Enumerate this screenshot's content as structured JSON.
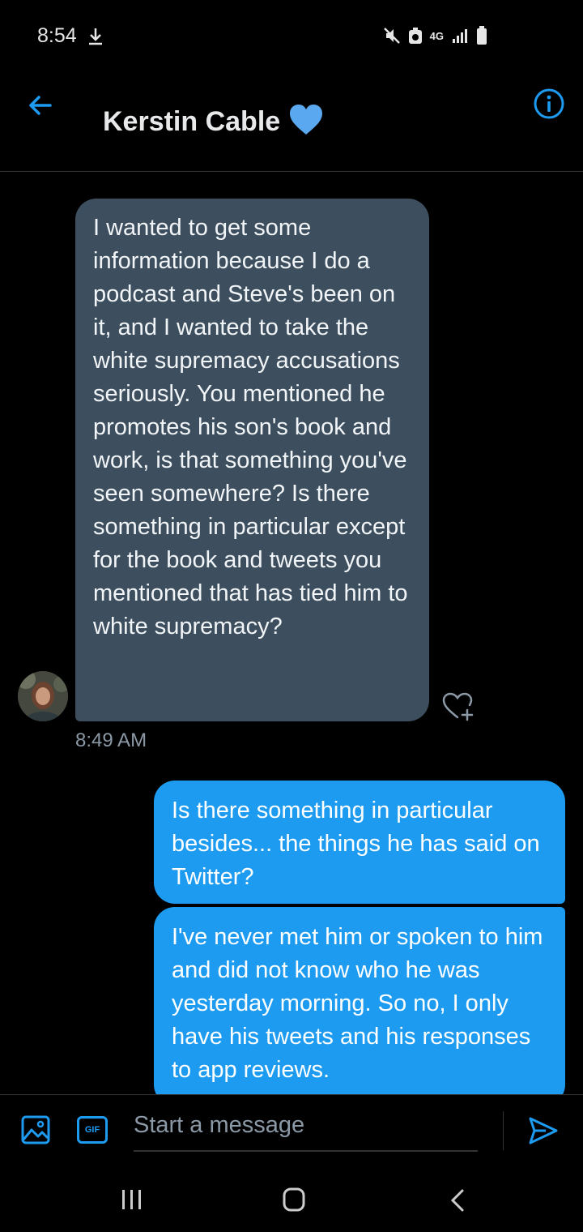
{
  "status_bar": {
    "time": "8:54",
    "network": "4G",
    "icons": [
      "download-icon",
      "mute-icon",
      "data-saver-icon",
      "signal-icon",
      "battery-icon"
    ]
  },
  "header": {
    "title": "Kerstin Cable",
    "badge_icon": "heart-icon",
    "back_icon": "back-arrow-icon",
    "info_icon": "info-icon"
  },
  "messages": {
    "incoming": {
      "text": "I wanted to get some information because I do a podcast and Steve's been on it, and I wanted to take the white supremacy accusations seriously. You mentioned he promotes his son's book and work, is that something you've seen somewhere? Is there something in particular except for the book and tweets you mentioned that has tied him to white supremacy?",
      "timestamp": "8:49 AM"
    },
    "outgoing": [
      {
        "text": "Is there something in particular besides... the things he has said on Twitter?"
      },
      {
        "text": "I've never met him or spoken to him and did not know who he was yesterday morning. So no, I only have his tweets and his responses to app reviews."
      }
    ]
  },
  "composer": {
    "placeholder": "Start a message",
    "gif_label": "GIF"
  },
  "colors": {
    "accent": "#1d9bf0",
    "incoming_bubble": "#3d4f5e",
    "background": "#000000"
  }
}
